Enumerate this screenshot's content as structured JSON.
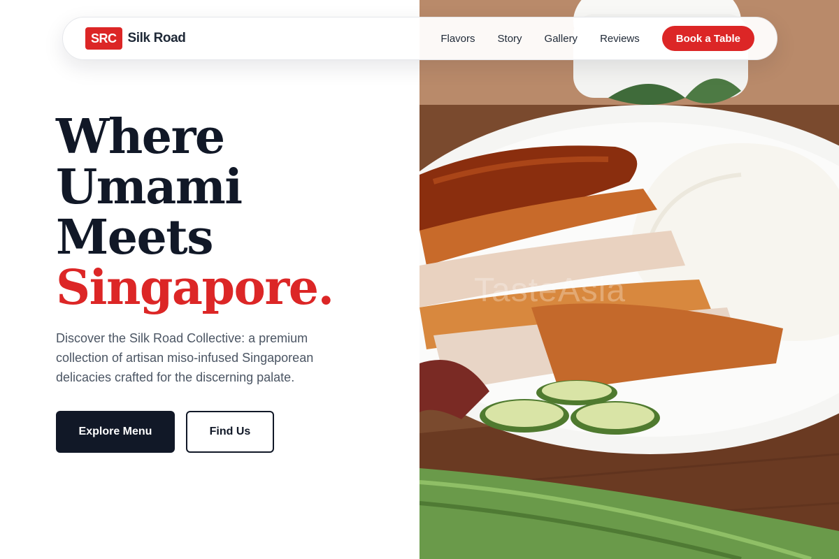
{
  "brand": {
    "badge": "SRC",
    "name": "Silk Road"
  },
  "nav": {
    "links": [
      "Flavors",
      "Story",
      "Gallery",
      "Reviews"
    ],
    "cta": "Book a Table"
  },
  "hero": {
    "headline": [
      "Where",
      "Umami",
      "Meets",
      "Singapore."
    ],
    "lede": "Discover the Silk Road Collective: a premium collection of artisan miso-infused Singaporean delicacies crafted for the discerning palate.",
    "primary_button": "Explore Menu",
    "secondary_button": "Find Us"
  },
  "image": {
    "watermark": "TasteAsia"
  },
  "colors": {
    "accent": "#dc2626",
    "dark": "#111827",
    "body_text": "#4b5563"
  }
}
